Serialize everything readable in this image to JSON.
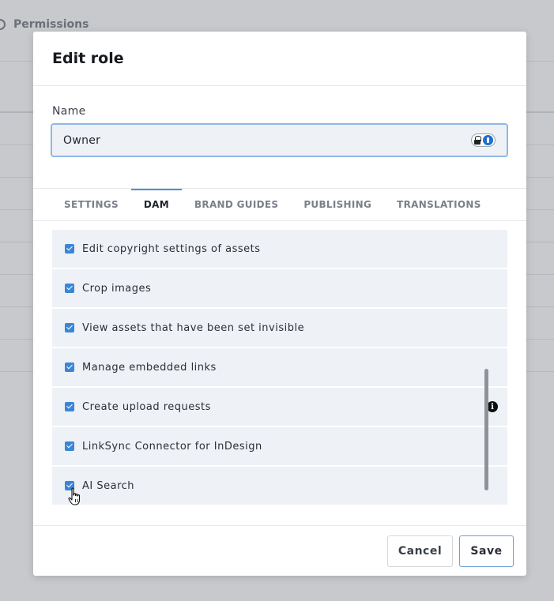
{
  "background": {
    "breadcrumb_label": "Permissions"
  },
  "dialog": {
    "title": "Edit role",
    "name_label": "Name",
    "name_value": "Owner",
    "tabs": [
      {
        "label": "SETTINGS",
        "active": false
      },
      {
        "label": "DAM",
        "active": true
      },
      {
        "label": "BRAND GUIDES",
        "active": false
      },
      {
        "label": "PUBLISHING",
        "active": false
      },
      {
        "label": "TRANSLATIONS",
        "active": false
      }
    ],
    "permissions": [
      {
        "label": "Edit copyright settings of assets",
        "checked": true
      },
      {
        "label": "Crop images",
        "checked": true
      },
      {
        "label": "View assets that have been set invisible",
        "checked": true
      },
      {
        "label": "Manage embedded links",
        "checked": true
      },
      {
        "label": "Create upload requests",
        "checked": true,
        "info_icon": "info-icon"
      },
      {
        "label": "LinkSync Connector for InDesign",
        "checked": true
      },
      {
        "label": "AI Search",
        "checked": true
      }
    ],
    "cancel_label": "Cancel",
    "save_label": "Save"
  },
  "colors": {
    "accent": "#3a86d6",
    "row_bg": "#eef1f6",
    "overlay": "#c7c9cc"
  }
}
